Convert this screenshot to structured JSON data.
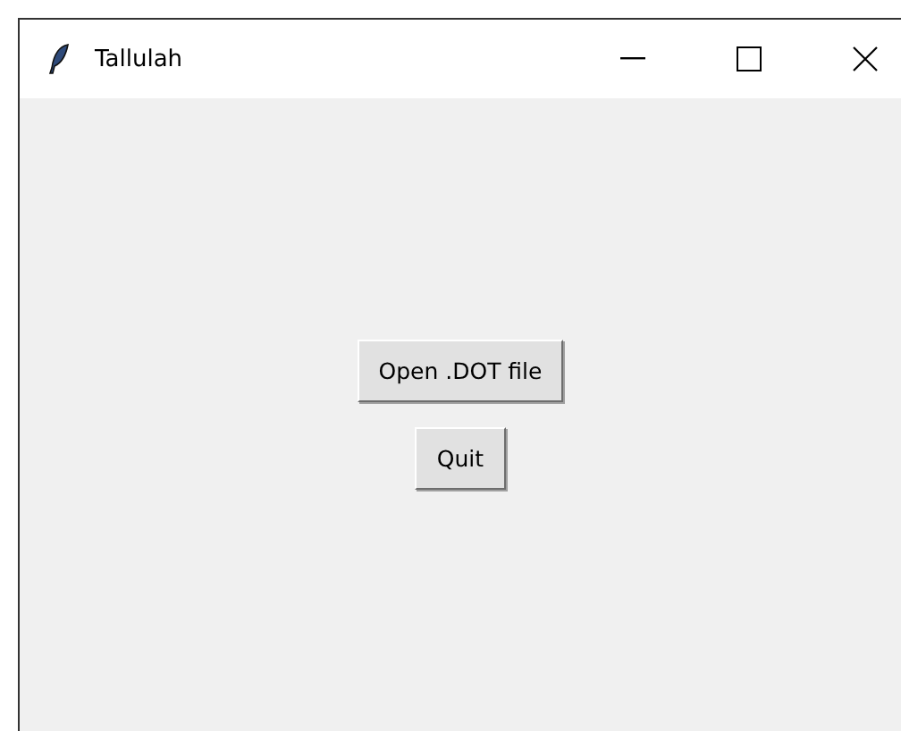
{
  "window": {
    "title": "Tallulah"
  },
  "buttons": [
    {
      "label": "Open .DOT file"
    },
    {
      "label": "Quit"
    }
  ]
}
